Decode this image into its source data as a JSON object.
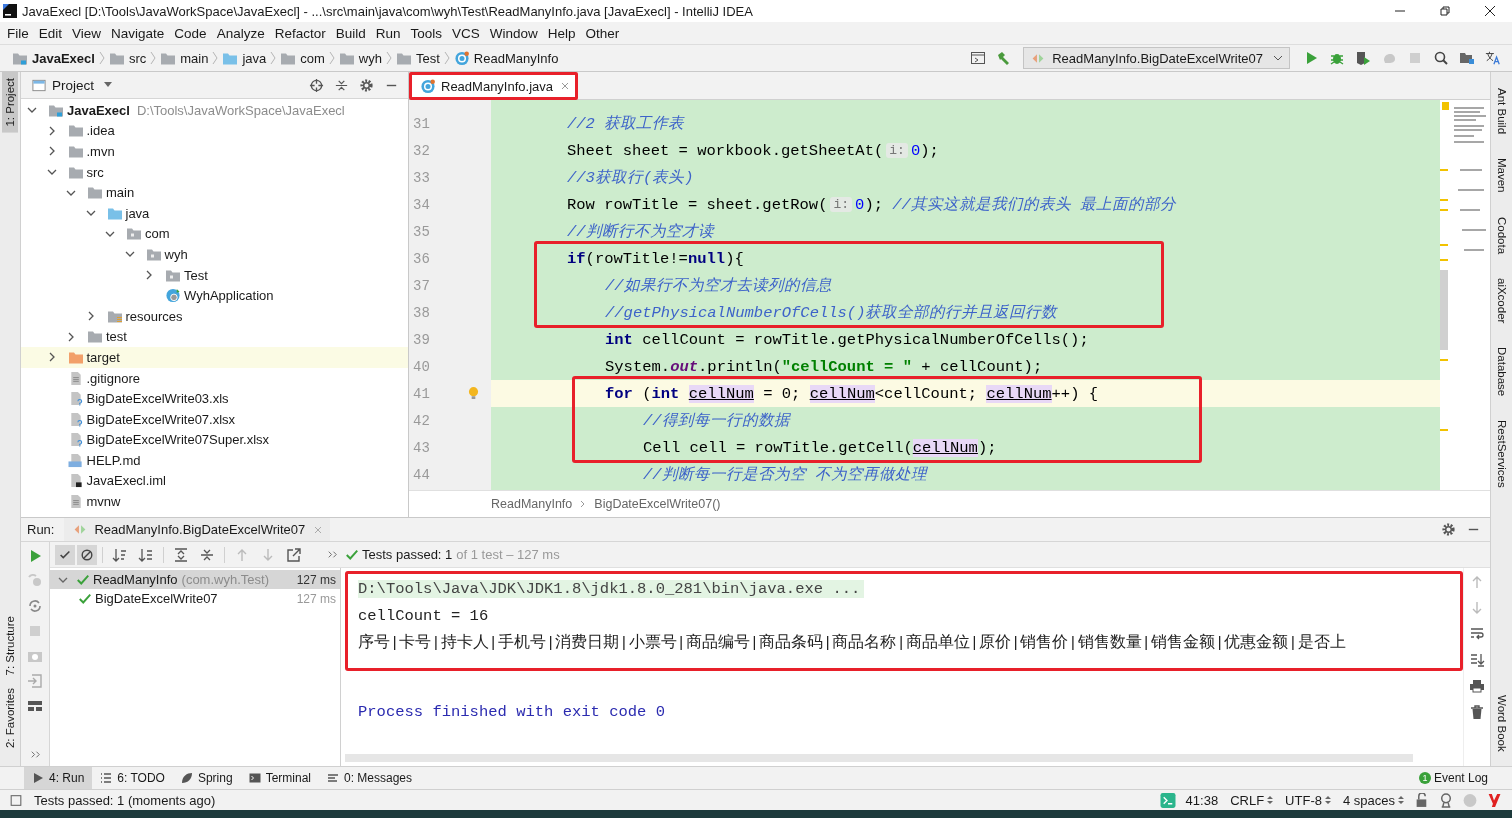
{
  "window": {
    "title": "JavaExecl [D:\\Tools\\JavaWorkSpace\\JavaExecl] - ...\\src\\main\\java\\com\\wyh\\Test\\ReadManyInfo.java [JavaExecl] - IntelliJ IDEA"
  },
  "menu": [
    "File",
    "Edit",
    "View",
    "Navigate",
    "Code",
    "Analyze",
    "Refactor",
    "Build",
    "Run",
    "Tools",
    "VCS",
    "Window",
    "Help",
    "Other"
  ],
  "breadcrumbs": [
    {
      "label": "JavaExecl",
      "kind": "project"
    },
    {
      "label": "src",
      "kind": "folder"
    },
    {
      "label": "main",
      "kind": "folder"
    },
    {
      "label": "java",
      "kind": "source"
    },
    {
      "label": "com",
      "kind": "package"
    },
    {
      "label": "wyh",
      "kind": "package"
    },
    {
      "label": "Test",
      "kind": "package"
    },
    {
      "label": "ReadManyInfo",
      "kind": "class"
    }
  ],
  "run_config": {
    "label": "ReadManyInfo.BigDateExcelWrite07"
  },
  "left_stripe": [
    {
      "label": "1: Project",
      "selected": true
    },
    {
      "label": "7: Structure",
      "selected": false
    },
    {
      "label": "2: Favorites",
      "selected": false
    }
  ],
  "right_stripe": [
    "Ant Build",
    "Maven",
    "Codota",
    "aiXcoder",
    "Database",
    "RestServices",
    "Word Book"
  ],
  "project_panel": {
    "title": "Project",
    "tree": [
      {
        "label": "JavaExecl",
        "hint": "D:\\Tools\\JavaWorkSpace\\JavaExecl",
        "kind": "project",
        "expanded": true,
        "selected": false,
        "children": [
          {
            "label": ".idea",
            "kind": "folder",
            "expanded": false,
            "selected": false
          },
          {
            "label": ".mvn",
            "kind": "folder",
            "expanded": false,
            "selected": false
          },
          {
            "label": "src",
            "kind": "folder",
            "expanded": true,
            "selected": false,
            "children": [
              {
                "label": "main",
                "kind": "folder",
                "expanded": true,
                "selected": false,
                "children": [
                  {
                    "label": "java",
                    "kind": "source",
                    "expanded": true,
                    "selected": false,
                    "children": [
                      {
                        "label": "com",
                        "kind": "package",
                        "expanded": true,
                        "selected": false,
                        "children": [
                          {
                            "label": "wyh",
                            "kind": "package",
                            "expanded": true,
                            "selected": false,
                            "children": [
                              {
                                "label": "Test",
                                "kind": "package",
                                "expanded": false,
                                "selected": false
                              },
                              {
                                "label": "WyhApplication",
                                "kind": "class",
                                "selected": false
                              }
                            ]
                          }
                        ]
                      }
                    ]
                  },
                  {
                    "label": "resources",
                    "kind": "resources",
                    "expanded": false,
                    "selected": false
                  }
                ]
              },
              {
                "label": "test",
                "kind": "folder",
                "expanded": false,
                "selected": false
              }
            ]
          },
          {
            "label": "target",
            "kind": "excluded",
            "expanded": false,
            "selected": true
          },
          {
            "label": ".gitignore",
            "kind": "file",
            "selected": false
          },
          {
            "label": "BigDateExcelWrite03.xls",
            "kind": "unknown",
            "selected": false
          },
          {
            "label": "BigDateExcelWrite07.xlsx",
            "kind": "unknown",
            "selected": false
          },
          {
            "label": "BigDateExcelWrite07Super.xlsx",
            "kind": "unknown",
            "selected": false
          },
          {
            "label": "HELP.md",
            "kind": "markdown",
            "selected": false
          },
          {
            "label": "JavaExecl.iml",
            "kind": "module",
            "selected": false
          },
          {
            "label": "mvnw",
            "kind": "file",
            "selected": false
          }
        ]
      }
    ]
  },
  "editor": {
    "tab": {
      "label": "ReadManyInfo.java",
      "selected": true,
      "boxed": true
    },
    "lines": [
      {
        "number": "31",
        "boxed": false,
        "tokens": [
          {
            "kind": "comment",
            "text": "//2 获取工作表"
          }
        ]
      },
      {
        "number": "32",
        "boxed": false,
        "tokens": [
          {
            "kind": "plain",
            "text": "Sheet sheet = workbook.getSheetAt("
          },
          {
            "kind": "hint",
            "text": "i:"
          },
          {
            "kind": "number",
            "text": "0"
          },
          {
            "kind": "plain",
            "text": ");"
          }
        ]
      },
      {
        "number": "33",
        "boxed": false,
        "tokens": [
          {
            "kind": "comment",
            "text": "//3获取行(表头)"
          }
        ]
      },
      {
        "number": "34",
        "boxed": false,
        "tokens": [
          {
            "kind": "plain",
            "text": "Row rowTitle = sheet.getRow("
          },
          {
            "kind": "hint",
            "text": "i:"
          },
          {
            "kind": "number",
            "text": "0"
          },
          {
            "kind": "plain",
            "text": "); "
          },
          {
            "kind": "comment",
            "text": "//其实这就是我们的表头 最上面的部分"
          }
        ]
      },
      {
        "number": "35",
        "boxed": false,
        "tokens": [
          {
            "kind": "comment",
            "text": "//判断行不为空才读"
          }
        ]
      },
      {
        "number": "36",
        "boxed": true,
        "tokens": [
          {
            "kind": "keyword",
            "text": "if"
          },
          {
            "kind": "plain",
            "text": "(rowTitle!="
          },
          {
            "kind": "keyword",
            "text": "null"
          },
          {
            "kind": "plain",
            "text": "){"
          }
        ],
        "children": [
          {
            "number": "37",
            "boxed": true,
            "tokens": [
              {
                "kind": "comment",
                "text": "//如果行不为空才去读列的信息"
              }
            ]
          },
          {
            "number": "38",
            "boxed": true,
            "tokens": [
              {
                "kind": "comment",
                "text": "//getPhysicalNumberOfCells()获取全部的行并且返回行数"
              }
            ]
          },
          {
            "number": "39",
            "boxed": false,
            "tokens": [
              {
                "kind": "keyword",
                "text": "int"
              },
              {
                "kind": "plain",
                "text": " cellCount = rowTitle.getPhysicalNumberOfCells();"
              }
            ]
          },
          {
            "number": "40",
            "boxed": false,
            "tokens": [
              {
                "kind": "plain",
                "text": "System."
              },
              {
                "kind": "field",
                "text": "out"
              },
              {
                "kind": "plain",
                "text": ".println("
              },
              {
                "kind": "string",
                "text": "\"cellCount = \""
              },
              {
                "kind": "plain",
                "text": " + cellCount);"
              }
            ]
          },
          {
            "number": "41",
            "boxed": true,
            "current": true,
            "bulb": true,
            "tokens": [
              {
                "kind": "keyword",
                "text": "for"
              },
              {
                "kind": "plain",
                "text": " ("
              },
              {
                "kind": "keyword",
                "text": "int "
              },
              {
                "kind": "var",
                "text": "cellNum"
              },
              {
                "kind": "plain",
                "text": " = 0; "
              },
              {
                "kind": "var",
                "text": "cellNum"
              },
              {
                "kind": "plain",
                "text": "<cellCount; "
              },
              {
                "kind": "var",
                "text": "cellNum"
              },
              {
                "kind": "plain",
                "text": "++) {"
              }
            ],
            "children": [
              {
                "number": "42",
                "boxed": true,
                "tokens": [
                  {
                    "kind": "comment",
                    "text": "//得到每一行的数据"
                  }
                ]
              },
              {
                "number": "43",
                "boxed": true,
                "tokens": [
                  {
                    "kind": "plain",
                    "text": "Cell cell = rowTitle.getCell("
                  },
                  {
                    "kind": "var",
                    "text": "cellNum"
                  },
                  {
                    "kind": "plain",
                    "text": ");"
                  }
                ]
              },
              {
                "number": "44",
                "boxed": false,
                "tokens": [
                  {
                    "kind": "comment",
                    "text": "//判断每一行是否为空 不为空再做处理"
                  }
                ]
              }
            ]
          }
        ]
      }
    ],
    "breadcrumb": [
      "ReadManyInfo",
      "BigDateExcelWrite07()"
    ]
  },
  "run": {
    "label": "Run:",
    "tab": "ReadManyInfo.BigDateExcelWrite07",
    "status": "Tests passed: 1",
    "detail": "of 1 test – 127 ms",
    "tests": [
      {
        "label": "ReadManyInfo",
        "hint": "(com.wyh.Test)",
        "time": "127 ms",
        "selected": true,
        "expanded": true,
        "children": [
          {
            "label": "BigDateExcelWrite07",
            "time": "127 ms",
            "selected": false
          }
        ]
      }
    ],
    "console": [
      {
        "kind": "command",
        "text": "D:\\Tools\\Java\\JDK\\JDK1.8\\jdk1.8.0_281\\bin\\java.exe ...",
        "boxed": true
      },
      {
        "kind": "output",
        "text": "cellCount = 16",
        "boxed": true
      },
      {
        "kind": "output",
        "text": "序号|卡号|持卡人|手机号|消费日期|小票号|商品编号|商品条码|商品名称|商品单位|原价|销售价|销售数量|销售金额|优惠金额|是否上",
        "boxed": true
      },
      {
        "kind": "exit",
        "text": "Process finished with exit code 0",
        "boxed": false
      }
    ]
  },
  "tool_tabs": [
    {
      "label": "4: Run",
      "kind": "run",
      "selected": true
    },
    {
      "label": "6: TODO",
      "kind": "todo",
      "selected": false
    },
    {
      "label": "Spring",
      "kind": "spring",
      "selected": false
    },
    {
      "label": "Terminal",
      "kind": "terminal",
      "selected": false
    },
    {
      "label": "0: Messages",
      "kind": "messages",
      "selected": false
    }
  ],
  "event_log": {
    "badge": "1",
    "label": "Event Log"
  },
  "status_bar": {
    "message": "Tests passed: 1 (moments ago)",
    "position": "41:38",
    "line_ending": "CRLF",
    "encoding": "UTF-8",
    "indent": "4 spaces"
  }
}
